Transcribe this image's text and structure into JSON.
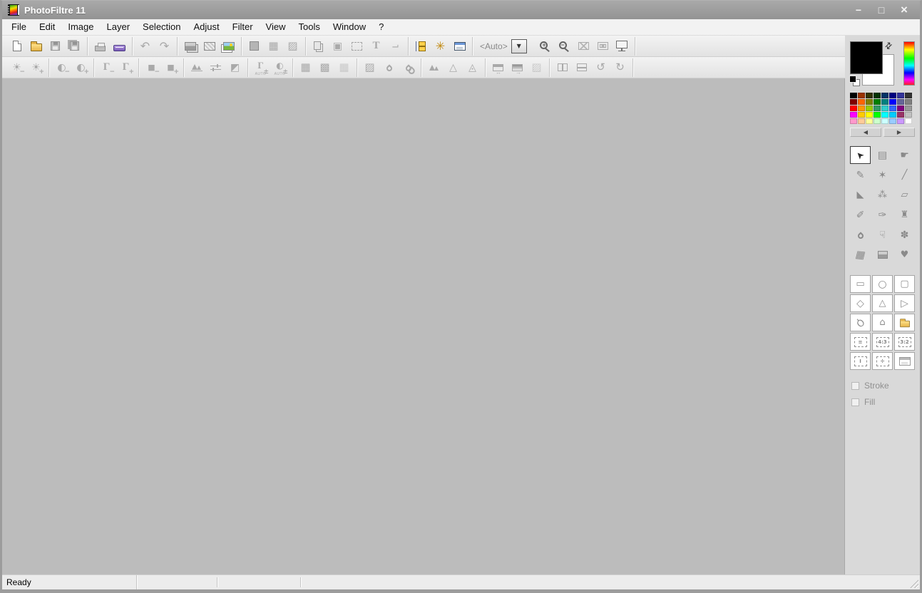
{
  "window": {
    "title": "PhotoFiltre 11",
    "controls": [
      {
        "name": "minimize-button",
        "glyph": "−"
      },
      {
        "name": "maximize-button",
        "glyph": "□"
      },
      {
        "name": "close-button",
        "glyph": "×"
      }
    ]
  },
  "menu": {
    "items": [
      "File",
      "Edit",
      "Image",
      "Layer",
      "Selection",
      "Adjust",
      "Filter",
      "View",
      "Tools",
      "Window",
      "?"
    ]
  },
  "toolbar_main": {
    "zoom_value": "<Auto>",
    "dropdown_glyph": "▼",
    "groups": [
      [
        {
          "n": "new-button",
          "css": "ic-page",
          "en": true
        },
        {
          "n": "open-button",
          "css": "ic-folder",
          "en": true
        },
        {
          "n": "save-button",
          "css": "ic-floppy",
          "en": false
        },
        {
          "n": "save-as-button",
          "css": "ic-floppy pin",
          "en": false
        }
      ],
      [
        {
          "n": "print-button",
          "css": "ic-printer",
          "en": false
        },
        {
          "n": "scan-button",
          "css": "ic-scanner",
          "en": true
        }
      ],
      [
        {
          "n": "undo-button",
          "g": "↶",
          "en": false,
          "fs": 16
        },
        {
          "n": "redo-button",
          "g": "↷",
          "en": false,
          "fs": 16
        }
      ],
      [
        {
          "n": "copy-button",
          "css": "ic-photo ph-gray ph-stack",
          "en": false
        },
        {
          "n": "paste-button",
          "css": "ic-photo ph-checker",
          "en": false
        },
        {
          "n": "paste-as-new-button",
          "css": "ic-photo ph-color ph-page",
          "en": true
        }
      ],
      [
        {
          "n": "image-size-button",
          "css": "ic-graybox",
          "en": false
        },
        {
          "n": "canvas-size-button",
          "g": "▦",
          "en": false
        },
        {
          "n": "transparent-color-button",
          "g": "▨",
          "en": false
        }
      ],
      [
        {
          "n": "duplicate-button",
          "css": "ic-dup",
          "en": false
        },
        {
          "n": "insert-image-button",
          "g": "▣",
          "en": false,
          "fs": 14
        },
        {
          "n": "show-selection-button",
          "css": "ic-dashbox",
          "en": false
        },
        {
          "n": "text-button",
          "g": "T",
          "en": false,
          "fs": 15,
          "cls": "serif"
        },
        {
          "n": "selection-path-button",
          "g": "⌐",
          "en": false,
          "fs": 13,
          "rot": 180
        }
      ],
      [
        {
          "n": "explorer-button",
          "css": "ic-tree",
          "en": true
        },
        {
          "n": "settings-button",
          "g": "✳",
          "c": "#c28a10",
          "en": true,
          "fs": 16
        },
        {
          "n": "image-properties-button",
          "css": "ic-dialog",
          "en": true
        }
      ]
    ],
    "view_group": [
      {
        "n": "zoom-in-button",
        "css": "ic-zoom zin",
        "en": true
      },
      {
        "n": "zoom-out-button",
        "css": "ic-zoom zout",
        "en": true
      },
      {
        "n": "fit-image-button",
        "css": "ic-fit",
        "en": false
      },
      {
        "n": "fit-window-button",
        "css": "ic-fit f2",
        "en": false
      },
      {
        "n": "full-screen-button",
        "css": "ic-screen",
        "en": true
      }
    ]
  },
  "toolbar_adjust": {
    "groups": [
      [
        {
          "n": "brightness-minus-button",
          "g": "☀",
          "s": "−",
          "en": false,
          "fs": 14
        },
        {
          "n": "brightness-plus-button",
          "g": "☀",
          "s": "+",
          "en": false,
          "fs": 14
        }
      ],
      [
        {
          "n": "contrast-minus-button",
          "g": "◐",
          "s": "−",
          "en": false,
          "fs": 14
        },
        {
          "n": "contrast-plus-button",
          "g": "◐",
          "s": "+",
          "en": false,
          "fs": 14
        }
      ],
      [
        {
          "n": "gamma-minus-button",
          "g": "Γ",
          "s": "−",
          "en": false,
          "fs": 15,
          "cls": "serif"
        },
        {
          "n": "gamma-plus-button",
          "g": "Γ",
          "s": "+",
          "en": false,
          "fs": 15,
          "cls": "serif"
        }
      ],
      [
        {
          "n": "saturation-minus-button",
          "g": "■",
          "s": "−",
          "en": false,
          "fs": 11
        },
        {
          "n": "saturation-plus-button",
          "g": "■",
          "s": "+",
          "en": false,
          "fs": 11
        }
      ],
      [
        {
          "n": "histogram-button",
          "css": "ic-mountains",
          "en": false
        },
        {
          "n": "levels-button",
          "css": "ic-sliders",
          "en": false
        },
        {
          "n": "invert-button",
          "g": "◩",
          "en": false,
          "fs": 14
        }
      ],
      [
        {
          "n": "auto-levels-button",
          "g": "Γ",
          "s": "±",
          "lbl": "AUTO",
          "en": false,
          "fs": 13,
          "cls": "serif up"
        },
        {
          "n": "auto-contrast-button",
          "g": "◐",
          "s": "±",
          "lbl": "AUTO",
          "en": false,
          "fs": 12,
          "cls": "up"
        }
      ],
      [
        {
          "n": "color-mode-1-button",
          "g": "▦",
          "en": false
        },
        {
          "n": "color-mode-2-button",
          "g": "▩",
          "en": false
        },
        {
          "n": "color-mode-3-button",
          "g": "▦",
          "en": false,
          "cls": "faint"
        }
      ],
      [
        {
          "n": "photomasque-button",
          "g": "▨",
          "en": false
        },
        {
          "n": "blur-button",
          "css": "ic-drop",
          "en": false
        },
        {
          "n": "blur-more-button",
          "css": "ic-drop d2",
          "en": false
        }
      ],
      [
        {
          "n": "relief-button",
          "css": "ic-mountains m2",
          "en": false
        },
        {
          "n": "soften-button",
          "g": "△",
          "en": false,
          "fs": 14
        },
        {
          "n": "sharpen-button",
          "g": "◬",
          "en": false,
          "fs": 14
        }
      ],
      [
        {
          "n": "frame-resize-button",
          "css": "ic-frameh",
          "en": false
        },
        {
          "n": "frame-gradient-button",
          "css": "ic-framegrad",
          "en": false
        },
        {
          "n": "frame-pattern-button",
          "g": "▨",
          "en": false,
          "cls": "faint"
        }
      ],
      [
        {
          "n": "mirror-horizontal-button",
          "css": "ic-book",
          "en": false
        },
        {
          "n": "mirror-vertical-button",
          "css": "ic-pages",
          "en": false
        },
        {
          "n": "rotate-left-button",
          "g": "↺",
          "en": false,
          "fs": 15
        },
        {
          "n": "rotate-right-button",
          "g": "↻",
          "en": false,
          "fs": 15
        }
      ]
    ]
  },
  "sidebar": {
    "foreground_color": "#000000",
    "background_color": "#ffffff",
    "swap_glyph": "⇄",
    "nav": {
      "prev": "◀",
      "next": "▶"
    },
    "palette": [
      "#000000",
      "#993300",
      "#333300",
      "#003300",
      "#003366",
      "#000080",
      "#333399",
      "#333333",
      "#800000",
      "#FF6600",
      "#808000",
      "#008000",
      "#008080",
      "#0000FF",
      "#666699",
      "#808080",
      "#FF0000",
      "#FF9900",
      "#99CC00",
      "#339966",
      "#33CCCC",
      "#3366FF",
      "#800080",
      "#999999",
      "#FF00FF",
      "#FFCC00",
      "#FFFF00",
      "#00FF00",
      "#00FFFF",
      "#00CCFF",
      "#993366",
      "#C0C0C0",
      "#FF99CC",
      "#FFCC99",
      "#FFFF99",
      "#CCFFCC",
      "#CCFFFF",
      "#99CCFF",
      "#CC99FF",
      "#FFFFFF"
    ],
    "tools": [
      {
        "n": "selection-arrow-tool",
        "g": "➤",
        "rot": -135,
        "sel": true,
        "c": "#2a2a2a",
        "fs": 13
      },
      {
        "n": "shape-palette-tool",
        "g": "▤",
        "fs": 14
      },
      {
        "n": "hand-tool",
        "g": "☛",
        "fs": 14
      },
      {
        "n": "eyedropper-tool",
        "g": "✎",
        "fs": 14
      },
      {
        "n": "magic-wand-tool",
        "g": "✶",
        "fs": 14
      },
      {
        "n": "line-tool",
        "g": "╱",
        "fs": 13
      },
      {
        "n": "fill-tool",
        "g": "◣",
        "fs": 13
      },
      {
        "n": "airbrush-tool",
        "g": "⁂",
        "fs": 13
      },
      {
        "n": "eraser-tool",
        "g": "▱",
        "fs": 13
      },
      {
        "n": "brush-tool",
        "g": "✐",
        "fs": 14
      },
      {
        "n": "advanced-brush-tool",
        "g": "✑",
        "fs": 14
      },
      {
        "n": "clone-stamp-tool",
        "g": "♜",
        "fs": 13
      },
      {
        "n": "blur-tool",
        "css": "ic-drop"
      },
      {
        "n": "smudge-tool",
        "g": "☟",
        "fs": 14
      },
      {
        "n": "artistic-brush-tool",
        "g": "✽",
        "fs": 14
      },
      {
        "n": "distort-tool",
        "g": "▦",
        "fs": 14,
        "skew": true
      },
      {
        "n": "pattern-tool",
        "css": "ic-photo ph-gray ph-small"
      },
      {
        "n": "nozzle-tool",
        "g": "♥",
        "fs": 13
      }
    ],
    "shapes": [
      {
        "n": "rectangle-shape",
        "g": "▭",
        "fs": 13
      },
      {
        "n": "ellipse-shape",
        "g": "○",
        "fs": 14
      },
      {
        "n": "rounded-rectangle-shape",
        "g": "▢",
        "fs": 13
      },
      {
        "n": "diamond-shape",
        "g": "◇",
        "fs": 14
      },
      {
        "n": "triangle-shape",
        "g": "△",
        "fs": 13
      },
      {
        "n": "right-triangle-shape",
        "g": "▷",
        "fs": 14
      },
      {
        "n": "lasso-shape",
        "g": "Ϙ",
        "fs": 13,
        "rot": 140
      },
      {
        "n": "polygon-shape",
        "g": "⌂",
        "fs": 13
      },
      {
        "n": "load-selection-button",
        "css": "ic-folder sm"
      },
      {
        "n": "selection-lines-button",
        "box": true,
        "txt": "≡"
      },
      {
        "n": "ratio-4-3-button",
        "box": true,
        "txt": "4:3"
      },
      {
        "n": "ratio-3-2-button",
        "box": true,
        "txt": "3:2"
      },
      {
        "n": "manual-size-button",
        "box": true,
        "txt": "I"
      },
      {
        "n": "transform-selection-button",
        "box": true,
        "txt": "✛"
      },
      {
        "n": "selection-settings-button",
        "css": "ic-dialog gray",
        "en": false
      }
    ],
    "stroke_label": "Stroke",
    "fill_label": "Fill"
  },
  "statusbar": {
    "ready": "Ready"
  }
}
